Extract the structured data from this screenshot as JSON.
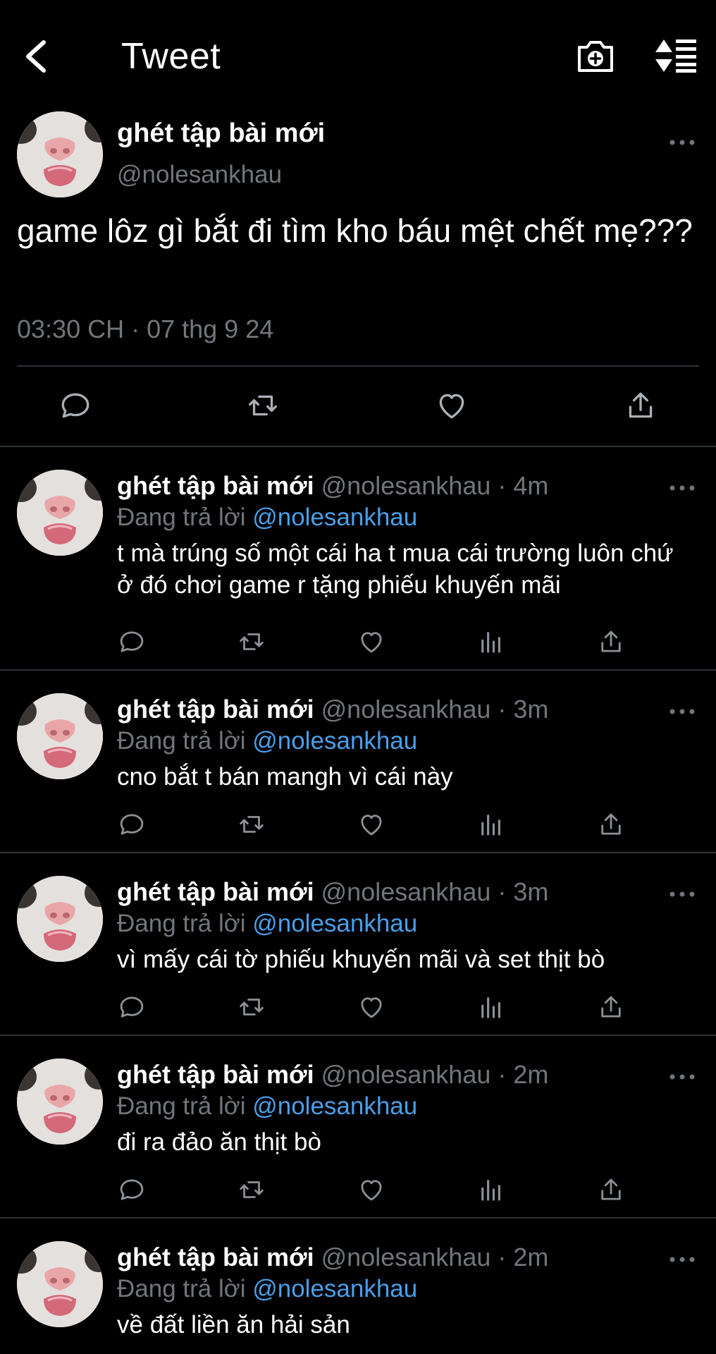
{
  "header": {
    "back_icon": "chevron-left-icon",
    "title": "Tweet",
    "camera_icon": "camera-plus-icon",
    "sort_icon": "sort-list-icon"
  },
  "main_tweet": {
    "name": "ghét tập bài mới",
    "handle": "@nolesankhau",
    "text": "game lôz gì bắt đi tìm kho báu mệt chết mẹ???",
    "meta": "03:30 CH · 07 thg 9 24",
    "actions": [
      "reply-icon",
      "retweet-icon",
      "like-icon",
      "share-icon"
    ]
  },
  "replies": [
    {
      "name": "ghét tập bài mới",
      "handle_time": "@nolesankhau · 4m",
      "reply_prefix": "Đang trả lời",
      "mention": "@nolesankhau",
      "text": "t mà trúng số một cái ha t mua cái trường luôn chứ ở đó chơi game r tặng phiếu khuyến mãi"
    },
    {
      "name": "ghét tập bài mới",
      "handle_time": "@nolesankhau · 3m",
      "reply_prefix": "Đang trả lời",
      "mention": "@nolesankhau",
      "text": "cno bắt t bán mangh vì cái này"
    },
    {
      "name": "ghét tập bài mới",
      "handle_time": "@nolesankhau · 3m",
      "reply_prefix": "Đang trả lời",
      "mention": "@nolesankhau",
      "text": "vì mấy cái tờ phiếu khuyến mãi và set thịt bò"
    },
    {
      "name": "ghét tập bài mới",
      "handle_time": "@nolesankhau · 2m",
      "reply_prefix": "Đang trả lời",
      "mention": "@nolesankhau",
      "text": "đi ra đảo ăn thịt bò"
    },
    {
      "name": "ghét tập bài mới",
      "handle_time": "@nolesankhau · 2m",
      "reply_prefix": "Đang trả lời",
      "mention": "@nolesankhau",
      "text": "về đất liền ăn hải sản"
    }
  ],
  "reply_actions": [
    "reply-icon",
    "retweet-icon",
    "like-icon",
    "analytics-icon",
    "share-icon"
  ],
  "colors": {
    "background": "#000000",
    "text": "#ffffff",
    "secondary": "#71767b",
    "mention": "#4a9fe8",
    "divider": "#2f3336"
  }
}
